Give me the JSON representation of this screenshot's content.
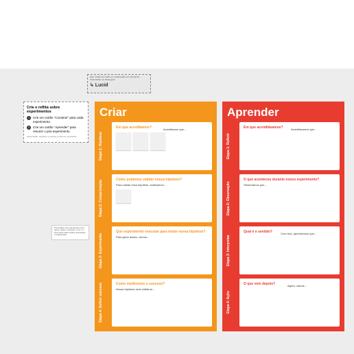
{
  "brand": {
    "hint": "Este modelo foi criado em colaboração com Alexander Osterwalder, do Strategyzer",
    "logo": "↳ Lucid"
  },
  "instr": {
    "title": "Crie e reflita sobre experimentos",
    "item1": "Crie um cartão \"Construir\" para cada experimento.",
    "item2": "Crie um cartão \"Aprender\" para resumir o pós-experimento.",
    "note": "Observação: duplique os cartões conforme necessário."
  },
  "tip": "Personalize sua nota adesiva como quiser: ajuste o tamanho, a cor e a fonte para refletir melhor suas ideias e preferências.",
  "criar": {
    "title": "Criar",
    "s1": {
      "label": "Etapa 1:\nHipótese",
      "q": "Em que acreditamos?",
      "hint": "Acreditamos que..."
    },
    "s2": {
      "label": "Etapa 2:\nComprovação",
      "q": "Como podemos validar nossa hipótese?",
      "hint": "Para validar essa hipótese, analisamos..."
    },
    "s3": {
      "label": "Etapa 3:\nExperimento",
      "q": "Que experimento executar para testar nossa hipótese?",
      "hint": "Para gerar dados, vamos..."
    },
    "s4": {
      "label": "Etapa 4:\nDefinir sucesso",
      "q": "Como mediremos o sucesso?",
      "hint": "Nossa hipótese será válida se..."
    }
  },
  "aprender": {
    "title": "Aprender",
    "s1": {
      "label": "Etapa 1:\nRefletir",
      "q": "Em que acreditávamos?",
      "hint": "Acreditávamos que..."
    },
    "s2": {
      "label": "Etapa 2:\nObservação",
      "q": "O que aconteceu durante nosso experimento?",
      "hint": "Observamos que..."
    },
    "s3": {
      "label": "Etapa 3:\nInterpretar",
      "q": "Qual é o sentido?",
      "hint": "Com isso, aprendemos que..."
    },
    "s4": {
      "label": "Etapa 4:\nAção",
      "q": "O que vem depois?",
      "hint": "Agora, vamos..."
    }
  }
}
